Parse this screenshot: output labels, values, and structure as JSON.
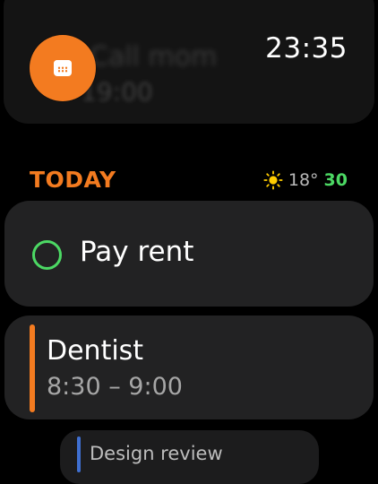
{
  "status": {
    "time": "23:35"
  },
  "app": {
    "icon": "calendar-icon",
    "accent_color": "#f37b20"
  },
  "previous_event": {
    "title": "Call mom",
    "time": "19:00"
  },
  "section": {
    "title": "TODAY"
  },
  "weather": {
    "icon": "sun-icon",
    "current_temp": "18°",
    "high_temp": "30",
    "high_color": "#4cd964"
  },
  "reminder": {
    "label": "Pay rent",
    "checkbox_color": "#4cd964"
  },
  "event": {
    "title": "Dentist",
    "time": "8:30 – 9:00",
    "color": "#f37b20"
  },
  "next_event": {
    "title": "Design review",
    "color": "#3f6fd0"
  }
}
